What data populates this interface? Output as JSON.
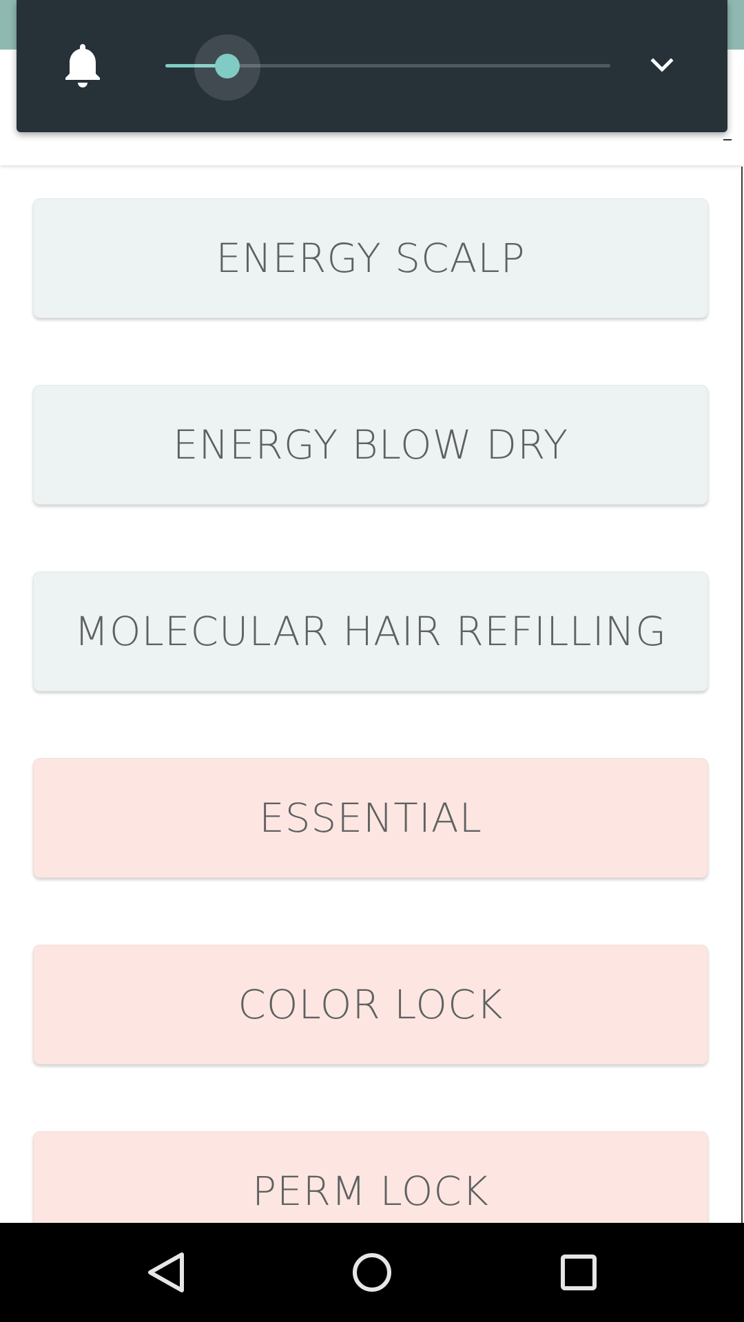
{
  "volume_panel": {
    "icon": "bell-icon",
    "slider_level": 0.14,
    "expand_icon": "chevron-down-icon",
    "accent_color": "#80cbc4",
    "background_color": "#263238"
  },
  "items": [
    {
      "label": "ENERGY SCALP",
      "color": "#edf2f2"
    },
    {
      "label": "ENERGY BLOW DRY",
      "color": "#edf2f2"
    },
    {
      "label": "MOLECULAR HAIR REFILLING",
      "color": "#edf2f2"
    },
    {
      "label": "ESSENTIAL",
      "color": "#fde6e2"
    },
    {
      "label": "COLOR LOCK",
      "color": "#fde6e2"
    },
    {
      "label": "PERM LOCK",
      "color": "#fde6e2"
    }
  ],
  "navbar": {
    "back_icon": "back-triangle-icon",
    "home_icon": "home-circle-icon",
    "recent_icon": "recent-apps-square-icon"
  }
}
